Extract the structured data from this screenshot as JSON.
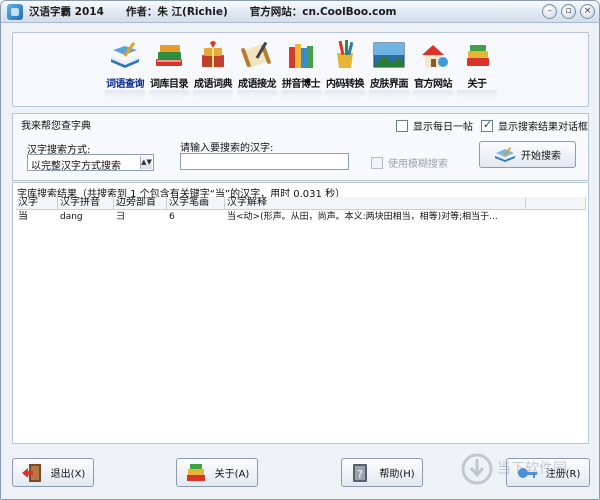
{
  "window": {
    "app_title": "汉语字霸 2014",
    "author": "作者：朱 江(Richie)",
    "website": "官方网站：cn.CoolBoo.com",
    "controls": [
      "minimize",
      "restore",
      "close"
    ]
  },
  "toolbar": {
    "items": [
      {
        "label": "词语查询",
        "icon": "book-pen-icon",
        "active": true
      },
      {
        "label": "词库目录",
        "icon": "books-stack-icon"
      },
      {
        "label": "成语词典",
        "icon": "gift-books-icon"
      },
      {
        "label": "成语接龙",
        "icon": "scroll-icon"
      },
      {
        "label": "拼音博士",
        "icon": "pinyin-books-icon"
      },
      {
        "label": "内码转换",
        "icon": "pencil-cup-icon"
      },
      {
        "label": "皮肤界面",
        "icon": "skin-landscape-icon"
      },
      {
        "label": "官方网站",
        "icon": "house-globe-icon"
      },
      {
        "label": "关于",
        "icon": "about-books-icon"
      }
    ]
  },
  "search": {
    "title": "我来帮您查字典",
    "show_daily_label": "显示每日一帖",
    "show_daily_checked": false,
    "show_dialog_label": "显示搜索结果对话框",
    "show_dialog_checked": true,
    "method_label": "汉字搜索方式:",
    "method_value": "以完整汉字方式搜索",
    "input_label": "请输入要搜索的汉字:",
    "input_value": "",
    "fuzzy_label": "使用模糊搜索",
    "fuzzy_checked": false,
    "search_button": "开始搜索"
  },
  "results": {
    "caption": "字库搜索结果（共搜索到 1 个包含有关键字“当”的汉字，用时 0.031 秒）",
    "columns": [
      "汉字",
      "汉字拼音",
      "边旁部首",
      "汉字笔画",
      "汉字解释",
      ""
    ],
    "rows": [
      [
        "当",
        "dang",
        "彐",
        "6",
        "当<动>(形声。从田，尚声。本义:两块田相当，相等)对等;相当于..."
      ]
    ]
  },
  "footer": {
    "exit": "退出(X)",
    "about": "关于(A)",
    "help": "帮助(H)",
    "register": "注册(R)"
  },
  "watermark": "当下软件园"
}
